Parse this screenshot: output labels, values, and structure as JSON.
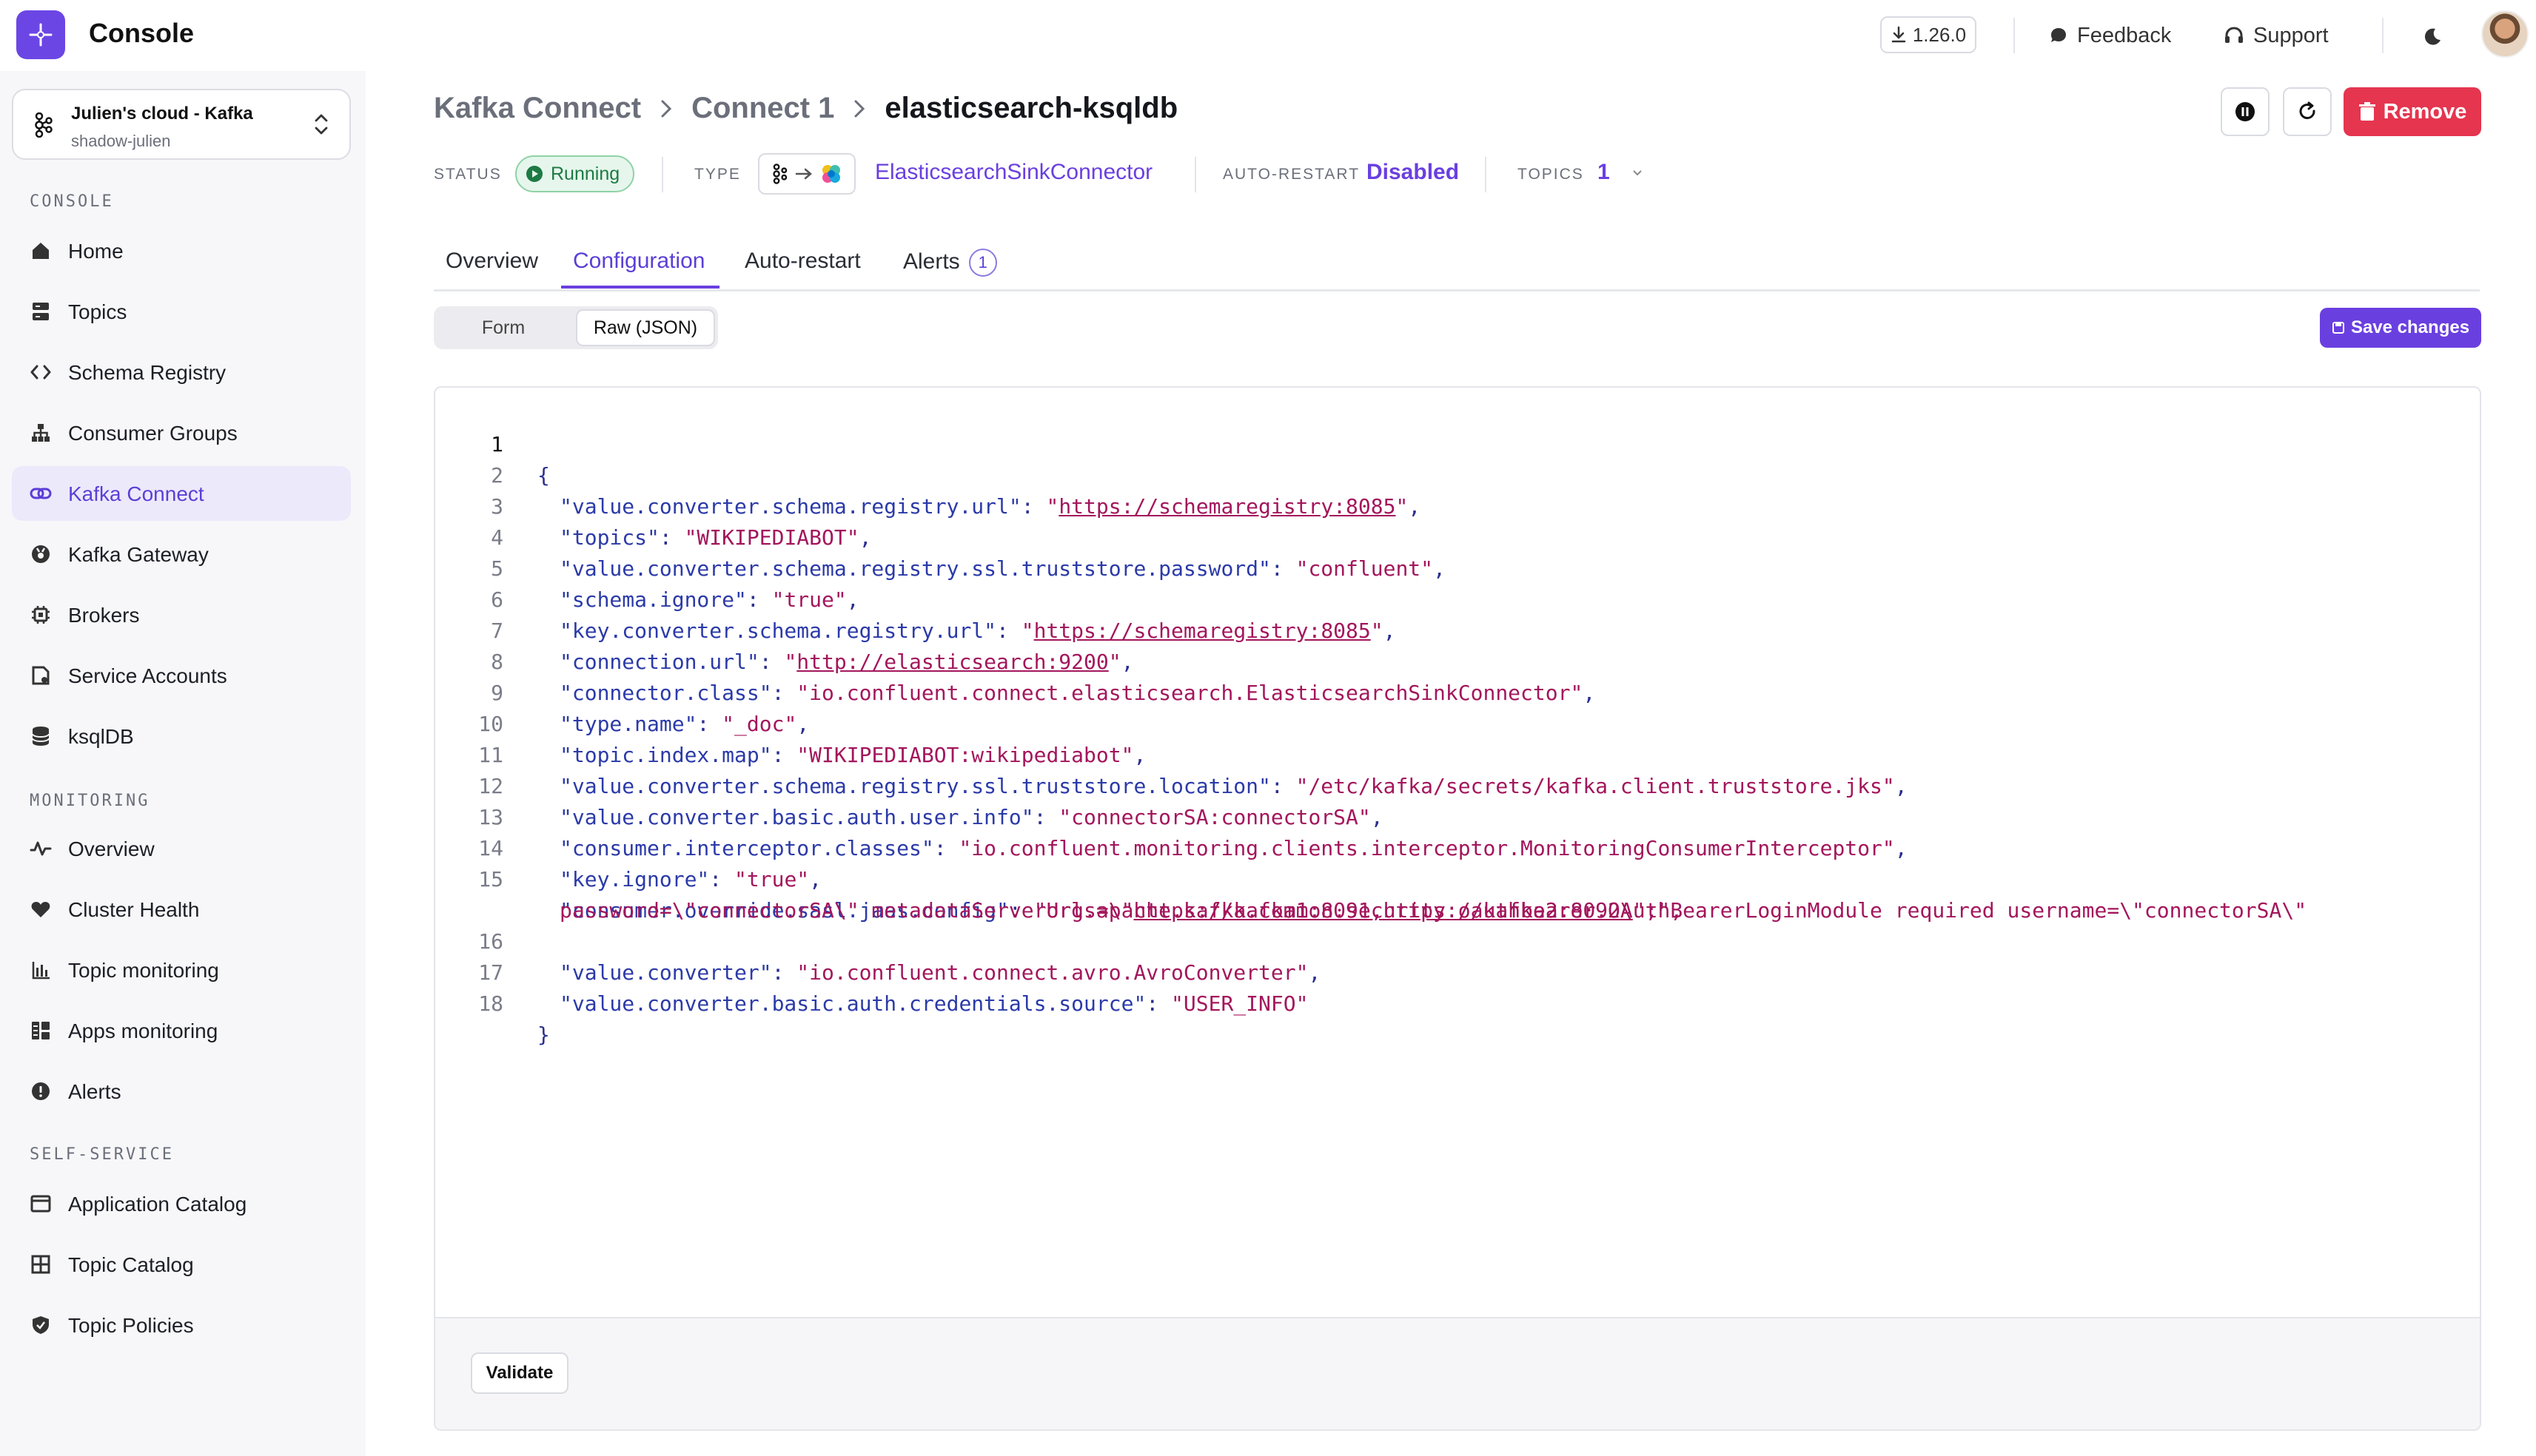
{
  "app": {
    "title": "Console",
    "version": "1.26.0"
  },
  "topbar": {
    "feedback": "Feedback",
    "support": "Support"
  },
  "cluster": {
    "name": "Julien's cloud - Kafka",
    "sub": "shadow-julien"
  },
  "sidebar": {
    "sections": {
      "console": "CONSOLE",
      "monitoring": "MONITORING",
      "self_service": "SELF-SERVICE"
    },
    "console_items": [
      {
        "label": "Home",
        "icon": "home-icon"
      },
      {
        "label": "Topics",
        "icon": "topics-icon"
      },
      {
        "label": "Schema Registry",
        "icon": "code-icon"
      },
      {
        "label": "Consumer Groups",
        "icon": "hierarchy-icon"
      },
      {
        "label": "Kafka Connect",
        "icon": "link-icon"
      },
      {
        "label": "Kafka Gateway",
        "icon": "gateway-icon"
      },
      {
        "label": "Brokers",
        "icon": "cpu-icon"
      },
      {
        "label": "Service Accounts",
        "icon": "account-icon"
      },
      {
        "label": "ksqlDB",
        "icon": "database-icon"
      }
    ],
    "monitoring_items": [
      {
        "label": "Overview",
        "icon": "activity-icon"
      },
      {
        "label": "Cluster Health",
        "icon": "heart-icon"
      },
      {
        "label": "Topic monitoring",
        "icon": "bar-chart-icon"
      },
      {
        "label": "Apps monitoring",
        "icon": "grid-icon"
      },
      {
        "label": "Alerts",
        "icon": "alert-icon"
      }
    ],
    "self_service_items": [
      {
        "label": "Application Catalog",
        "icon": "catalog-icon"
      },
      {
        "label": "Topic Catalog",
        "icon": "table-icon"
      },
      {
        "label": "Topic Policies",
        "icon": "shield-icon"
      }
    ],
    "active": "Kafka Connect"
  },
  "breadcrumb": [
    "Kafka Connect",
    "Connect 1",
    "elasticsearch-ksqldb"
  ],
  "header_actions": {
    "remove": "Remove"
  },
  "meta": {
    "status_label": "STATUS",
    "status_value": "Running",
    "type_label": "TYPE",
    "type_value": "ElasticsearchSinkConnector",
    "autorestart_label": "AUTO-RESTART",
    "autorestart_value": "Disabled",
    "topics_label": "TOPICS",
    "topics_value": "1"
  },
  "tabs": [
    {
      "label": "Overview"
    },
    {
      "label": "Configuration"
    },
    {
      "label": "Auto-restart"
    },
    {
      "label": "Alerts",
      "count": "1"
    }
  ],
  "active_tab": "Configuration",
  "view_toggle": {
    "form": "Form",
    "raw": "Raw (JSON)",
    "selected": "Raw (JSON)"
  },
  "save_label": "Save changes",
  "validate_label": "Validate",
  "editor": {
    "lines": [
      "{",
      "\"value.converter.schema.registry.url\": \"https://schemaregistry:8085\",",
      "\"topics\": \"WIKIPEDIABOT\",",
      "\"value.converter.schema.registry.ssl.truststore.password\": \"confluent\",",
      "\"schema.ignore\": \"true\",",
      "\"key.converter.schema.registry.url\": \"https://schemaregistry:8085\",",
      "\"connection.url\": \"http://elasticsearch:9200\",",
      "\"connector.class\": \"io.confluent.connect.elasticsearch.ElasticsearchSinkConnector\",",
      "\"type.name\": \"_doc\",",
      "\"topic.index.map\": \"WIKIPEDIABOT:wikipediabot\",",
      "\"value.converter.schema.registry.ssl.truststore.location\": \"/etc/kafka/secrets/kafka.client.truststore.jks\",",
      "\"value.converter.basic.auth.user.info\": \"connectorSA:connectorSA\",",
      "\"consumer.interceptor.classes\": \"io.confluent.monitoring.clients.interceptor.MonitoringConsumerInterceptor\",",
      "\"key.ignore\": \"true\",",
      "\"consumer.override.sasl.jaas.config\": \"org.apache.kafka.common.security.oauthbearer.OAuthBearerLoginModule required username=\\\"connectorSA\\\" password=\\\"connectorSA\\\" metadataServerUrls=\\\"https://kafka1:8091,https://kafka2:8092\\\";\",",
      "\"value.converter\": \"io.confluent.connect.avro.AvroConverter\",",
      "\"value.converter.basic.auth.credentials.source\": \"USER_INFO\"",
      "}"
    ],
    "line_numbers": [
      "1",
      "2",
      "3",
      "4",
      "5",
      "6",
      "7",
      "8",
      "9",
      "10",
      "11",
      "12",
      "13",
      "14",
      "15",
      "16",
      "17",
      "18"
    ],
    "wrapped_line_15": {
      "first": "\"org.apache.kafka.common.security.oauthbearer.OAuthBearerLoginModule required username=\\\"connectorSA\\\"",
      "second_pre": "password=\\\"connectorSA\\\" metadataServerUrls=\\\"",
      "second_url": "https://kafka1:8091,https://kafka2:8092\\",
      "second_post": "\";\","
    }
  },
  "colors": {
    "accent": "#6a3fe0",
    "danger": "#e5354f",
    "running": "#1d7a43",
    "json_key": "#2b3aa8",
    "json_string": "#a3165c"
  }
}
